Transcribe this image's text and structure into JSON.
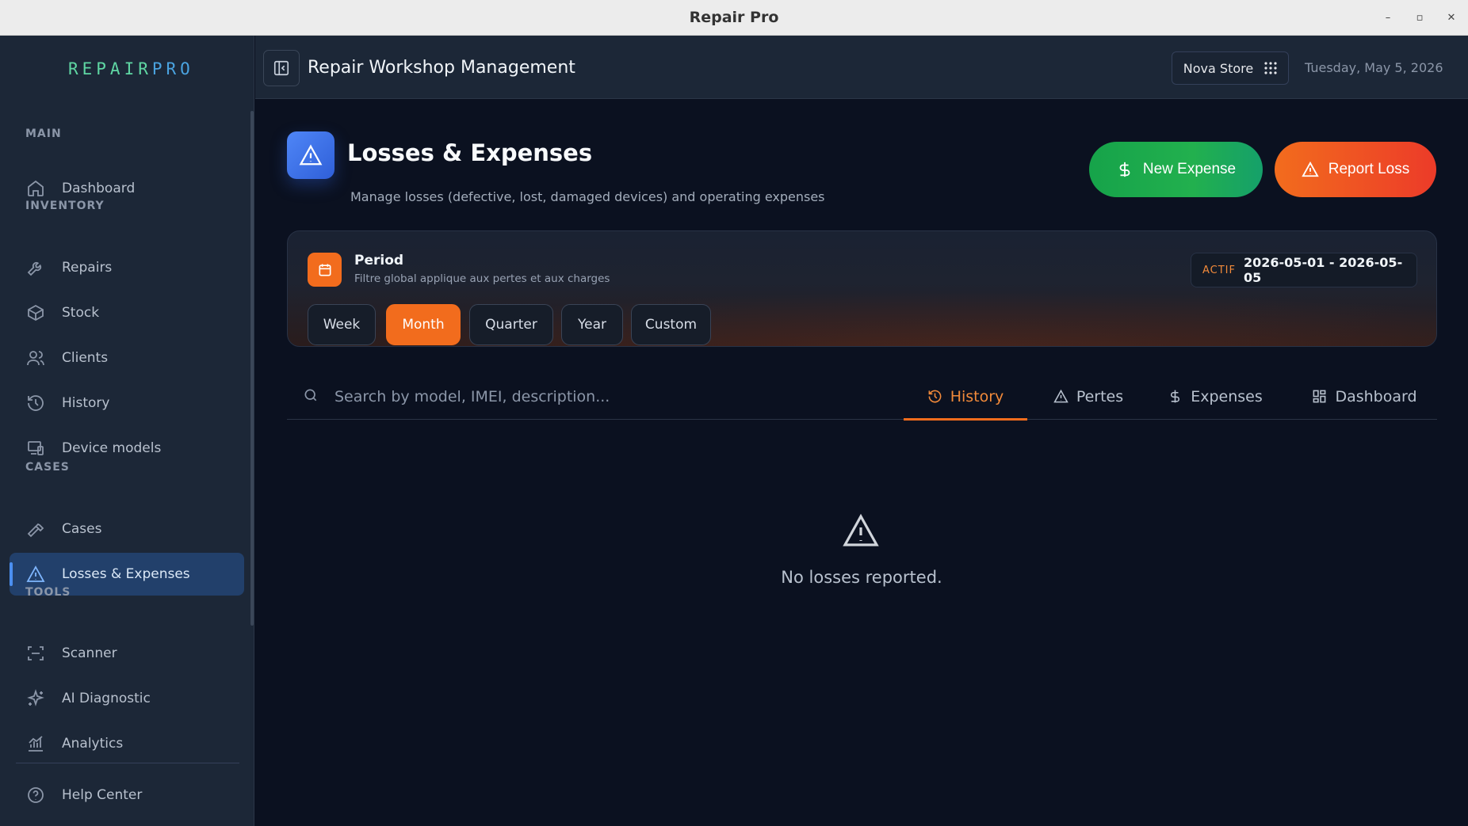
{
  "window": {
    "title": "Repair Pro",
    "controls": [
      "–",
      "▫",
      "✕"
    ]
  },
  "sidebar": {
    "logo_part1": "REPAIR",
    "logo_part2": "PRO",
    "sections": {
      "main": "MAIN",
      "inventory": "INVENTORY",
      "cases": "CASES",
      "tools": "TOOLS"
    },
    "items": {
      "dashboard": "Dashboard",
      "repairs": "Repairs",
      "stock": "Stock",
      "clients": "Clients",
      "history": "History",
      "device_models": "Device models",
      "cases": "Cases",
      "losses": "Losses & Expenses",
      "scanner": "Scanner",
      "ai": "AI Diagnostic",
      "analytics": "Analytics",
      "help": "Help Center"
    },
    "active_item": "losses"
  },
  "header": {
    "title": "Repair Workshop Management",
    "store": "Nova Store",
    "date": "Tuesday, May 5, 2026"
  },
  "page": {
    "title": "Losses & Expenses",
    "subtitle": "Manage losses (defective, lost, damaged devices) and operating expenses",
    "new_expense": "New Expense",
    "report_loss": "Report Loss"
  },
  "period": {
    "title": "Period",
    "subtitle": "Filtre global applique aux pertes et aux charges",
    "active_label": "ACTIF",
    "range": "2026-05-01 - 2026-05-05",
    "options": [
      "Week",
      "Month",
      "Quarter",
      "Year",
      "Custom"
    ],
    "selected": "Month"
  },
  "search": {
    "placeholder": "Search by model, IMEI, description..."
  },
  "tabs": {
    "history": "History",
    "losses": "Pertes",
    "expenses": "Expenses",
    "dashboard": "Dashboard",
    "active": "history"
  },
  "empty": {
    "message": "No losses reported."
  },
  "colors": {
    "accent_orange": "#f26c1d",
    "accent_green": "#16a34a",
    "accent_blue": "#4f86f7",
    "sidebar_bg": "#1c2737",
    "main_bg": "#0b1120"
  }
}
